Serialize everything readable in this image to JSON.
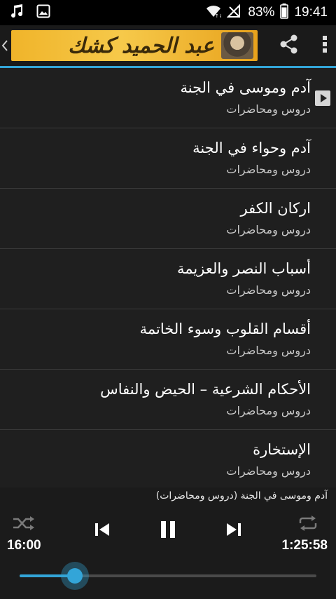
{
  "status_bar": {
    "battery_percent": "83%",
    "time": "19:41",
    "icons": [
      "music-note-icon",
      "image-icon",
      "wifi-icon",
      "no-signal-icon",
      "battery-icon"
    ]
  },
  "action_bar": {
    "logo_text": "عبد الحميد كشك",
    "icons": [
      "back-chevron-icon",
      "share-icon",
      "overflow-menu-icon"
    ]
  },
  "list": {
    "items": [
      {
        "title": "آدم وموسى في الجنة",
        "subtitle": "دروس ومحاضرات",
        "playing": true
      },
      {
        "title": "آدم وحواء في الجنة",
        "subtitle": "دروس ومحاضرات",
        "playing": false
      },
      {
        "title": "اركان الكفر",
        "subtitle": "دروس ومحاضرات",
        "playing": false
      },
      {
        "title": "أسباب النصر والعزيمة",
        "subtitle": "دروس ومحاضرات",
        "playing": false
      },
      {
        "title": "أقسام القلوب وسوء الخاتمة",
        "subtitle": "دروس ومحاضرات",
        "playing": false
      },
      {
        "title": "الأحكام الشرعية – الحيض والنفاس",
        "subtitle": "دروس ومحاضرات",
        "playing": false
      },
      {
        "title": "الإستخارة",
        "subtitle": "دروس ومحاضرات",
        "playing": false
      }
    ]
  },
  "player": {
    "now_playing": "آدم وموسى في الجنة (دروس ومحاضرات)",
    "elapsed": "16:00",
    "duration": "1:25:58",
    "progress_fraction": 0.186,
    "accent_color": "#33a5d8",
    "icons": [
      "shuffle-icon",
      "previous-icon",
      "pause-icon",
      "next-icon",
      "repeat-icon"
    ]
  }
}
